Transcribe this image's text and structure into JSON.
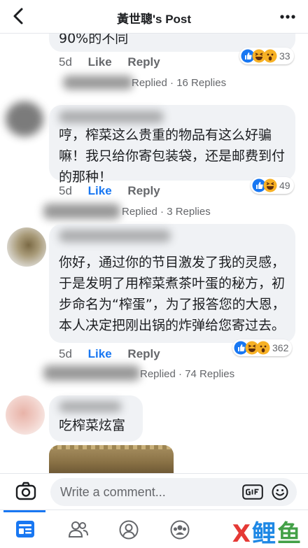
{
  "header": {
    "title": "黃世聰's Post"
  },
  "comments": [
    {
      "text_tail": "90%的不同",
      "time": "5d",
      "like": "Like",
      "reply": "Reply",
      "reaction_count": "33",
      "replies": "Replied · 16 Replies"
    },
    {
      "text": "哼，榨菜这么贵重的物品有这么好骗嘛！我只给你寄包装袋，还是邮费到付的那种！",
      "time": "5d",
      "like": "Like",
      "reply": "Reply",
      "reaction_count": "49",
      "replies": "Replied · 3 Replies"
    },
    {
      "text": "你好，通过你的节目激发了我的灵感，于是发明了用榨菜煮茶叶蛋的秘方，初步命名为“榨蛋”，为了报答您的大恩，本人决定把刚出锅的炸弹给您寄过去。",
      "time": "5d",
      "like": "Like",
      "reply": "Reply",
      "reaction_count": "362",
      "replies": "Replied · 74 Replies"
    },
    {
      "text": "吃榨菜炫富"
    }
  ],
  "composer": {
    "placeholder": "Write a comment..."
  },
  "watermark": {
    "x": "X",
    "a": "鲤",
    "b": "鱼"
  },
  "colors": {
    "accent": "#1877f2",
    "bubble": "#f0f2f5",
    "secondary": "#65676b"
  }
}
